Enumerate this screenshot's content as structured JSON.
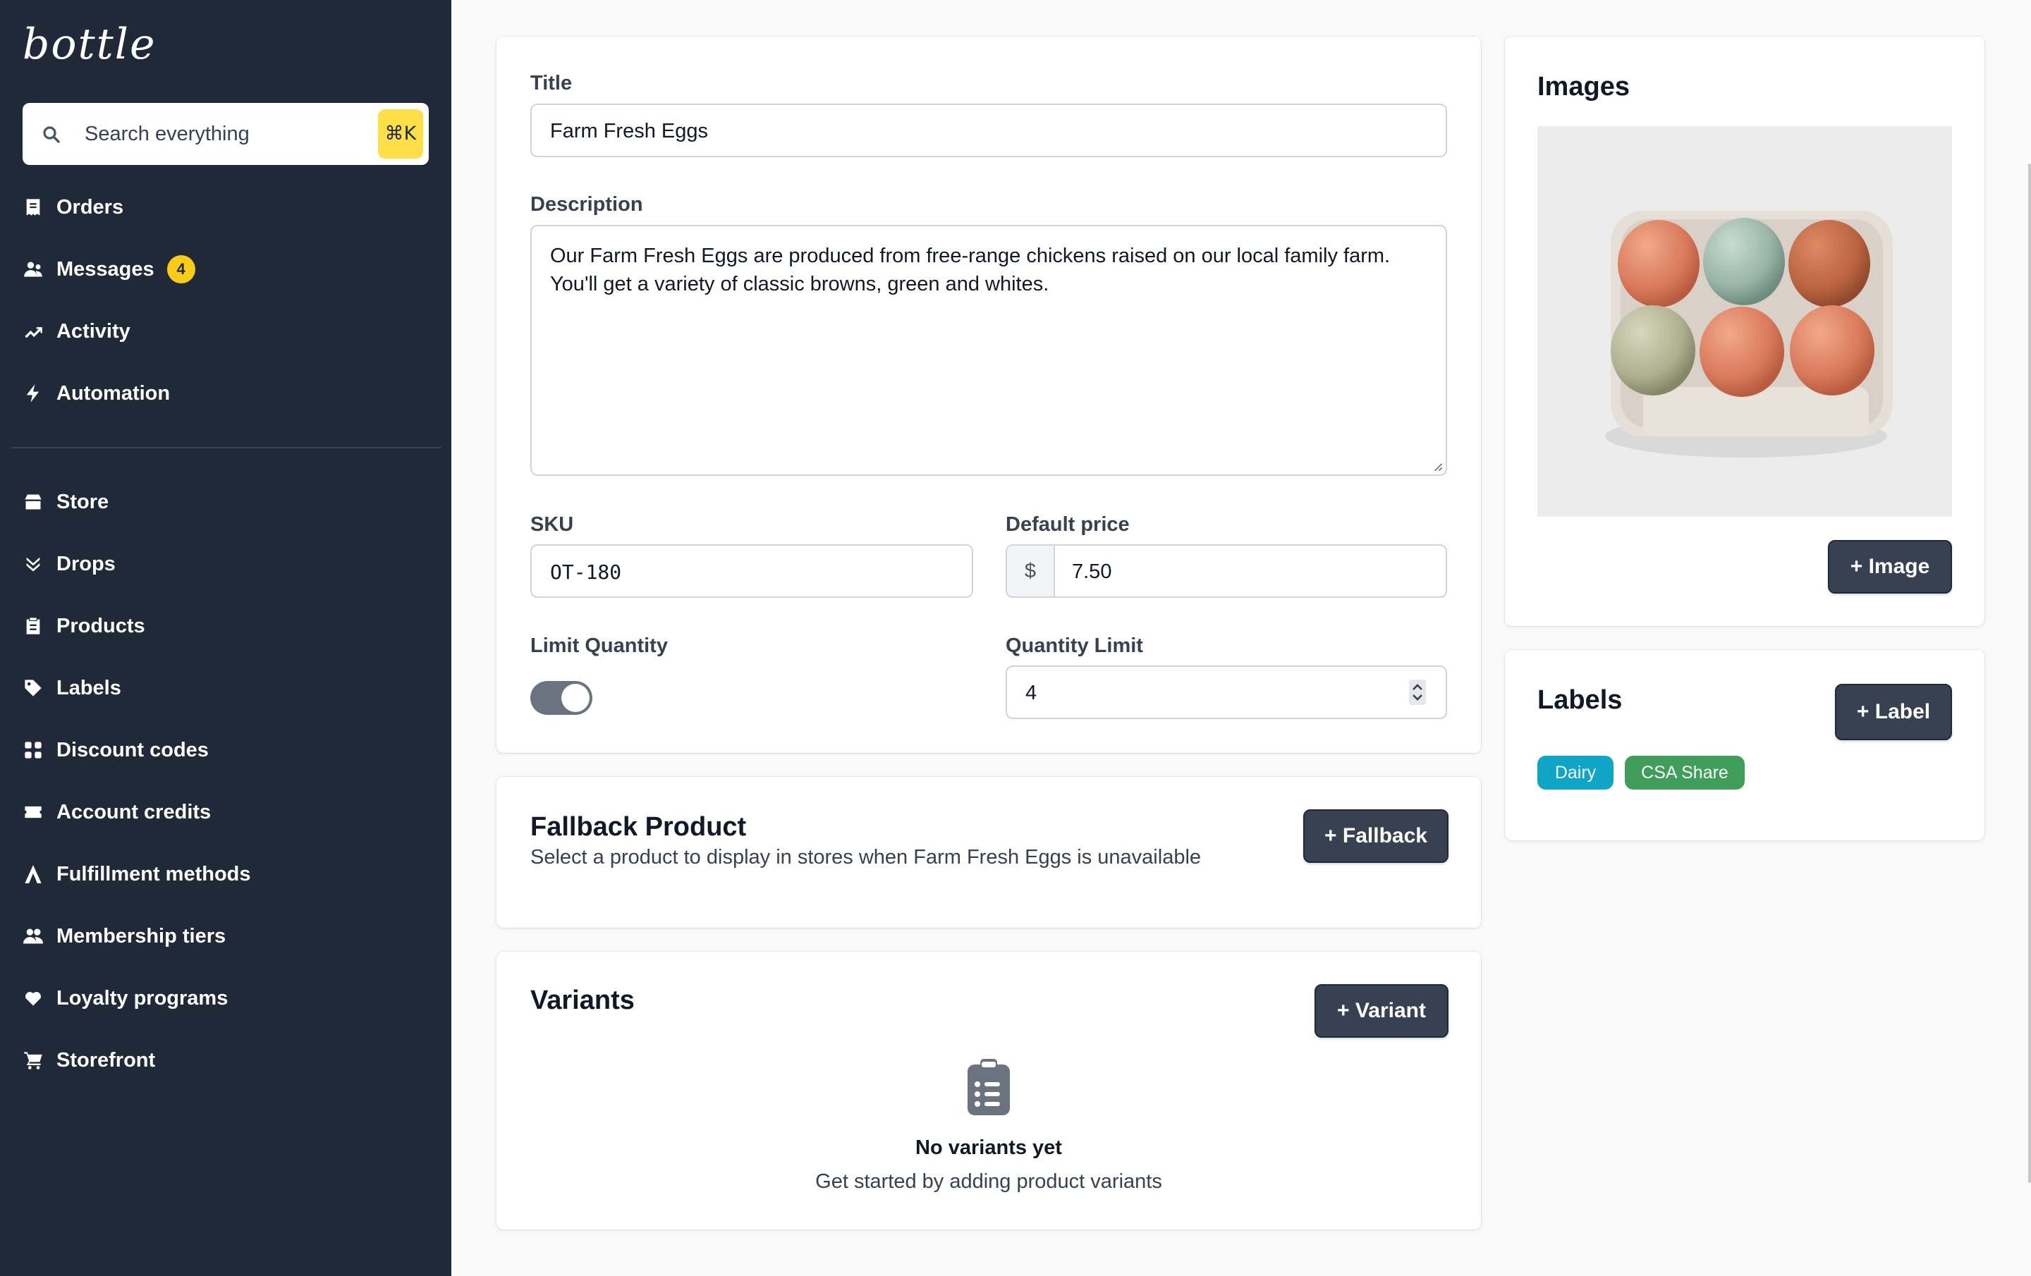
{
  "app": {
    "logo": "bottle"
  },
  "search": {
    "placeholder": "Search everything",
    "shortcut": "⌘K"
  },
  "sidebar": {
    "items": [
      {
        "label": "Orders",
        "icon": "receipt-icon"
      },
      {
        "label": "Messages",
        "icon": "users-icon",
        "badge": "4"
      },
      {
        "label": "Activity",
        "icon": "trending-up-icon"
      },
      {
        "label": "Automation",
        "icon": "bolt-icon"
      },
      {
        "label": "Store",
        "icon": "store-icon"
      },
      {
        "label": "Drops",
        "icon": "chevrons-down-icon"
      },
      {
        "label": "Products",
        "icon": "clipboard-icon"
      },
      {
        "label": "Labels",
        "icon": "tag-icon"
      },
      {
        "label": "Discount codes",
        "icon": "grid-icon"
      },
      {
        "label": "Account credits",
        "icon": "ticket-icon"
      },
      {
        "label": "Fulfillment methods",
        "icon": "triangle-icon"
      },
      {
        "label": "Membership tiers",
        "icon": "users-icon"
      },
      {
        "label": "Loyalty programs",
        "icon": "heart-icon"
      },
      {
        "label": "Storefront",
        "icon": "cart-icon"
      }
    ]
  },
  "product": {
    "title_label": "Title",
    "title_value": "Farm Fresh Eggs",
    "description_label": "Description",
    "description_value": "Our Farm Fresh Eggs are produced from free-range chickens raised on our local family farm. You'll get a variety of classic browns, green and whites.",
    "sku_label": "SKU",
    "sku_value": "OT-180",
    "price_label": "Default price",
    "price_currency": "$",
    "price_value": "7.50",
    "limit_label": "Limit Quantity",
    "limit_enabled": true,
    "quantity_limit_label": "Quantity Limit",
    "quantity_limit_value": "4"
  },
  "fallback": {
    "title": "Fallback Product",
    "subtitle": "Select a product to display in stores when Farm Fresh Eggs is unavailable",
    "button": "+ Fallback"
  },
  "variants": {
    "title": "Variants",
    "button": "+ Variant",
    "empty_title": "No variants yet",
    "empty_sub": "Get started by adding product variants"
  },
  "images": {
    "title": "Images",
    "button": "+ Image"
  },
  "labels": {
    "title": "Labels",
    "button": "+ Label",
    "tags": [
      {
        "name": "Dairy",
        "color": "#0ea5c6"
      },
      {
        "name": "CSA Share",
        "color": "#3f9e5a"
      }
    ]
  },
  "colors": {
    "sidebar": "#1f2937",
    "button": "#374151",
    "badge": "#facc15",
    "shortcut": "#fde047"
  }
}
